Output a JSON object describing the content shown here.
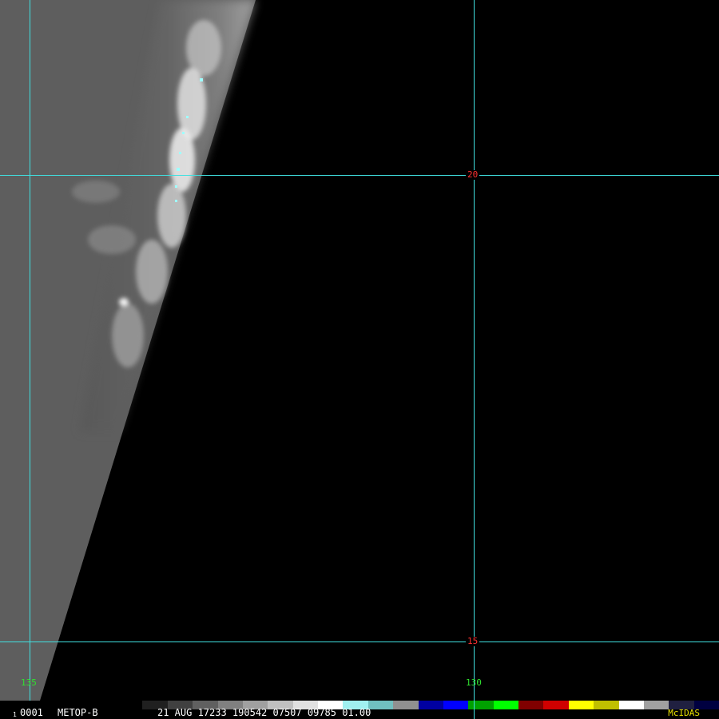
{
  "image": {
    "satellite": "METOP-B",
    "frame": "0001",
    "frame_marker": "1",
    "header_line": "21 AUG 17233 190542 07507 09785 01.00",
    "brand": "McIDAS",
    "brand_color": "#e8e000"
  },
  "grid": {
    "line_color": "#40e0e0",
    "latitudes": [
      {
        "label": "20",
        "value": 20
      },
      {
        "label": "15",
        "value": 15
      }
    ],
    "longitudes": [
      {
        "label": "135",
        "value": 135
      },
      {
        "label": "130",
        "value": 130
      }
    ],
    "lat_label_color": "#ff3030",
    "lon_label_color": "#30e030"
  },
  "colorbar": {
    "segments": [
      "#000000",
      "#202020",
      "#404040",
      "#606060",
      "#808080",
      "#a0a0a0",
      "#c0c0c0",
      "#e0e0e0",
      "#ffffff",
      "#a0f0f0",
      "#70c0c0",
      "#909090",
      "#0000a0",
      "#0000ff",
      "#00a000",
      "#00ff00",
      "#800000",
      "#d00000",
      "#ffff00",
      "#c0c000",
      "#ffffff",
      "#a0a0a0",
      "#202040",
      "#000040"
    ]
  }
}
